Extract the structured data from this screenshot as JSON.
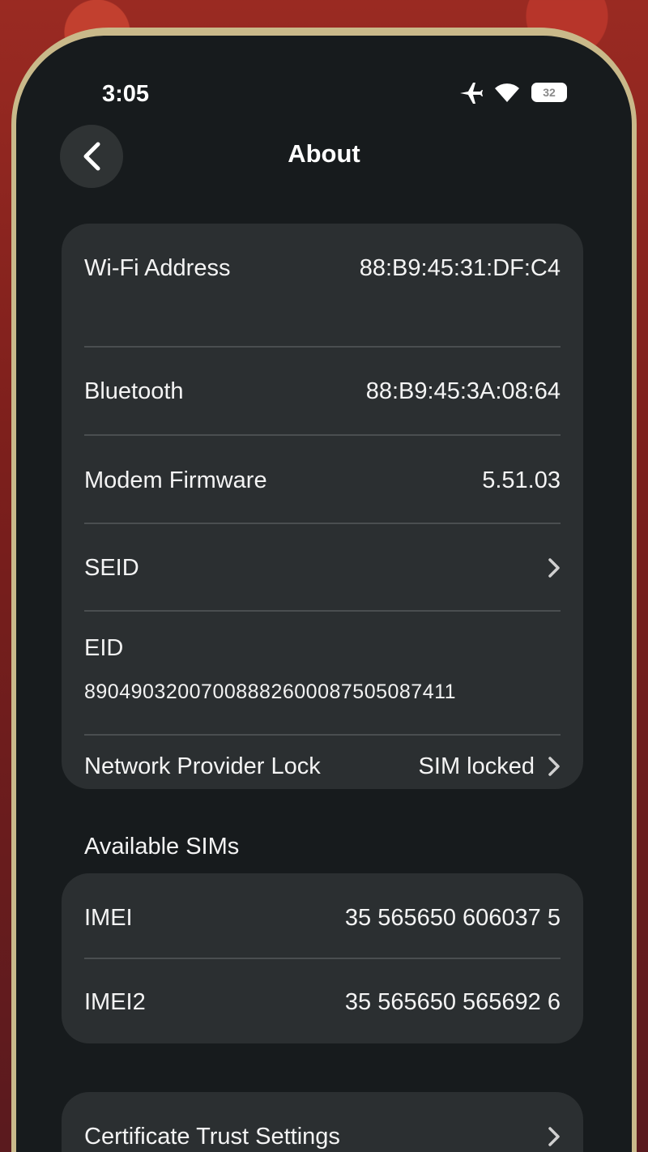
{
  "status_bar": {
    "time": "3:05",
    "battery": "32"
  },
  "nav": {
    "title": "About",
    "back_icon": "chevron-left-icon"
  },
  "about_rows": [
    {
      "label": "Wi-Fi Address",
      "value": "88:B9:45:31:DF:C4"
    },
    {
      "label": "Bluetooth",
      "value": "88:B9:45:3A:08:64"
    },
    {
      "label": "Modem Firmware",
      "value": "5.51.03"
    },
    {
      "label": "SEID",
      "value": ""
    }
  ],
  "eid": {
    "label": "EID",
    "value": "89049032007008882600087505087411"
  },
  "network_lock": {
    "label": "Network Provider Lock",
    "value": "SIM locked"
  },
  "available_sims": {
    "header": "Available SIMs",
    "rows": [
      {
        "label": "IMEI",
        "value": "35 565650 606037 5"
      },
      {
        "label": "IMEI2",
        "value": "35 565650 565692 6"
      }
    ]
  },
  "certificate": {
    "label": "Certificate Trust Settings"
  },
  "colors": {
    "screen_bg": "#171b1d",
    "card_bg": "#2b2f31",
    "text": "#f4f4f4"
  }
}
